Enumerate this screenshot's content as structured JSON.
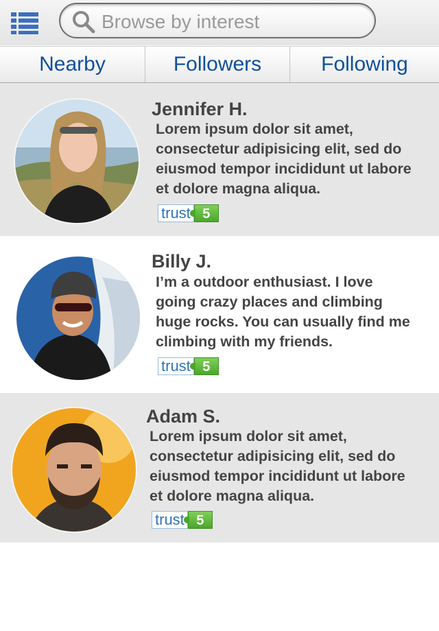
{
  "search": {
    "placeholder": "Browse by interest"
  },
  "tabs": [
    "Nearby",
    "Followers",
    "Following"
  ],
  "people": [
    {
      "name": "Jennifer H.",
      "bio": "Lorem ipsum dolor sit amet,\nconsectetur adipisicing elit, sed do\neiusmod tempor incididunt ut labore\net dolore magna aliqua.",
      "trust_label": "trust",
      "trust_score": "5"
    },
    {
      "name": "Billy J.",
      "bio": "I’m a outdoor enthusiast. I love\ngoing crazy places and climbing\nhuge rocks. You can usually find me\nclimbing with my friends.",
      "trust_label": "trust",
      "trust_score": "5"
    },
    {
      "name": "Adam S.",
      "bio": "Lorem ipsum dolor sit amet,\nconsectetur adipisicing elit, sed do\neiusmod tempor incididunt ut labore\net dolore magna aliqua.",
      "trust_label": "trust",
      "trust_score": "5"
    }
  ],
  "colors": {
    "tab_text": "#0f4f9e",
    "trust_green": "#4da62a",
    "trust_blue": "#2f73b8"
  }
}
